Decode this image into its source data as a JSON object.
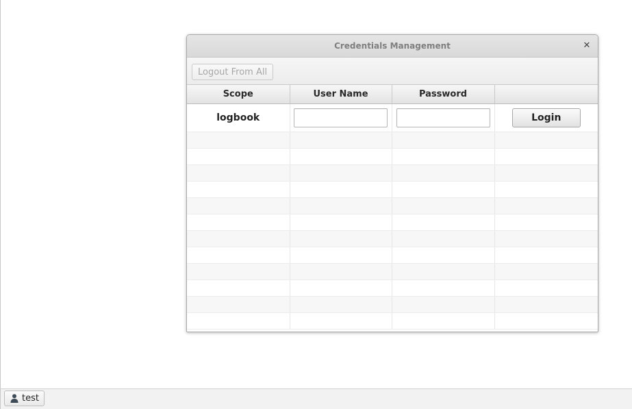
{
  "dialog": {
    "title": "Credentials Management",
    "close_glyph": "✕"
  },
  "toolbar": {
    "logout_all_label": "Logout From All"
  },
  "table": {
    "columns": [
      "Scope",
      "User Name",
      "Password",
      ""
    ],
    "rows": [
      {
        "scope": "logbook",
        "username_value": "",
        "password_value": "",
        "action_label": "Login"
      }
    ]
  },
  "statusbar": {
    "user_icon": "user-icon",
    "user_label": "test"
  }
}
